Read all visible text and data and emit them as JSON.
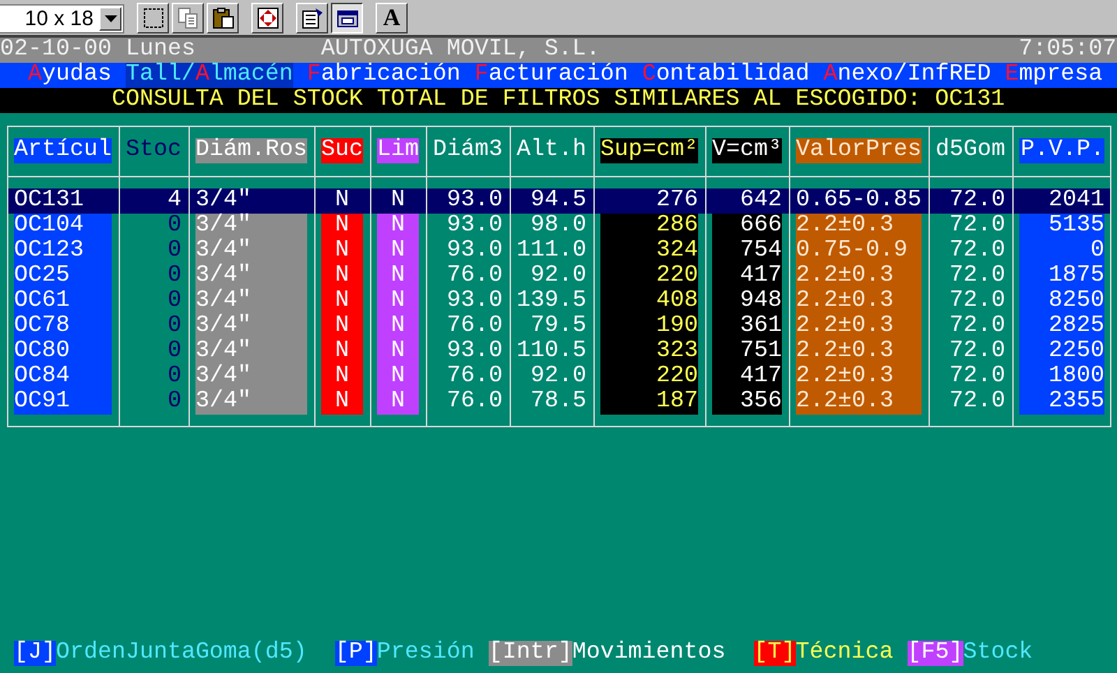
{
  "toolbar": {
    "font_size": {
      "value": "10 x 18"
    },
    "tools": [
      {
        "kind": "mark",
        "pressed": false
      },
      {
        "kind": "copy",
        "pressed": false
      },
      {
        "kind": "paste",
        "pressed": false
      },
      {
        "kind": "fullscreen",
        "pressed": false
      },
      {
        "kind": "properties",
        "pressed": false
      },
      {
        "kind": "background",
        "pressed": true
      },
      {
        "kind": "font",
        "label": "A",
        "pressed": false
      }
    ]
  },
  "status_line": {
    "date": "02-10-00 Lunes",
    "company": "AUTOXUGA MOVIL, S.L.",
    "time": "7:05:07"
  },
  "menu": [
    {
      "hotkey": "A",
      "after": "yudas",
      "selected": false
    },
    {
      "before": "Tall/",
      "hotkey": "A",
      "after": "lmacén",
      "selected": true
    },
    {
      "hotkey": "F",
      "after": "abricación",
      "selected": false
    },
    {
      "hotkey": "F",
      "after": "acturación",
      "selected": false
    },
    {
      "hotkey": "C",
      "after": "ontabilidad",
      "selected": false
    },
    {
      "hotkey": "A",
      "after": "nexo/InfRED",
      "selected": false
    },
    {
      "hotkey": "E",
      "after": "mpresa",
      "selected": false
    }
  ],
  "title": "CONSULTA DEL STOCK TOTAL DE FILTROS SIMILARES AL ESCOGIDO: OC131",
  "table": {
    "columns": [
      {
        "label": "Artícul",
        "color": "#0040ff",
        "kind": "text"
      },
      {
        "label": "Stoc",
        "kind": "stock"
      },
      {
        "label": "Diám.Ros",
        "color": "#8c8c8c",
        "kind": "text"
      },
      {
        "label": "Suc",
        "color": "#ff0000",
        "kind": "flag"
      },
      {
        "label": "Lim",
        "color": "#c040ff",
        "kind": "flag"
      },
      {
        "label": "Diám3",
        "kind": "number"
      },
      {
        "label": "Alt.h",
        "kind": "number"
      },
      {
        "label": "Sup=cm²",
        "color": "#000000",
        "kind": "highlight"
      },
      {
        "label": "V=cm³",
        "color": "#000000",
        "kind": "number"
      },
      {
        "label": "ValorPres",
        "color": "#c05a00",
        "kind": "range"
      },
      {
        "label": "d5Gom",
        "kind": "number"
      },
      {
        "label": "P.V.P.",
        "color": "#0040ff",
        "kind": "number"
      }
    ],
    "rows": [
      {
        "selected": true,
        "cells": [
          "OC131",
          "4",
          "3/4\"",
          "N",
          "N",
          "93.0",
          "94.5",
          "276",
          "642",
          "0.65-0.85",
          "72.0",
          "2041"
        ]
      },
      {
        "selected": false,
        "cells": [
          "OC104",
          "0",
          "3/4\"",
          "N",
          "N",
          "93.0",
          "98.0",
          "286",
          "666",
          "2.2±0.3",
          "72.0",
          "5135"
        ]
      },
      {
        "selected": false,
        "cells": [
          "OC123",
          "0",
          "3/4\"",
          "N",
          "N",
          "93.0",
          "111.0",
          "324",
          "754",
          "0.75-0.9",
          "72.0",
          "0"
        ]
      },
      {
        "selected": false,
        "cells": [
          "OC25",
          "0",
          "3/4\"",
          "N",
          "N",
          "76.0",
          "92.0",
          "220",
          "417",
          "2.2±0.3",
          "72.0",
          "1875"
        ]
      },
      {
        "selected": false,
        "cells": [
          "OC61",
          "0",
          "3/4\"",
          "N",
          "N",
          "93.0",
          "139.5",
          "408",
          "948",
          "2.2±0.3",
          "72.0",
          "8250"
        ]
      },
      {
        "selected": false,
        "cells": [
          "OC78",
          "0",
          "3/4\"",
          "N",
          "N",
          "76.0",
          "79.5",
          "190",
          "361",
          "2.2±0.3",
          "72.0",
          "2825"
        ]
      },
      {
        "selected": false,
        "cells": [
          "OC80",
          "0",
          "3/4\"",
          "N",
          "N",
          "93.0",
          "110.5",
          "323",
          "751",
          "2.2±0.3",
          "72.0",
          "2250"
        ]
      },
      {
        "selected": false,
        "cells": [
          "OC84",
          "0",
          "3/4\"",
          "N",
          "N",
          "76.0",
          "92.0",
          "220",
          "417",
          "2.2±0.3",
          "72.0",
          "1800"
        ]
      },
      {
        "selected": false,
        "cells": [
          "OC91",
          "0",
          "3/4\"",
          "N",
          "N",
          "76.0",
          "78.5",
          "187",
          "356",
          "2.2±0.3",
          "72.0",
          "2355"
        ]
      }
    ]
  },
  "footer": [
    {
      "key": "[J]",
      "label": "OrdenJuntaGoma(d5)",
      "color": "#0040ff",
      "kind": "normal"
    },
    {
      "key": "[P]",
      "label": "Presión",
      "color": "#0040ff",
      "kind": "normal"
    },
    {
      "key": "[Intr]",
      "label": "Movimientos",
      "color": "#8c8c8c",
      "kind": "plain"
    },
    {
      "key": "[T]",
      "label": "Técnica",
      "color": "#ff0000",
      "kind": "warning"
    },
    {
      "key": "[F5]",
      "label": "Stock",
      "color": "#c040ff",
      "kind": "normal"
    }
  ]
}
